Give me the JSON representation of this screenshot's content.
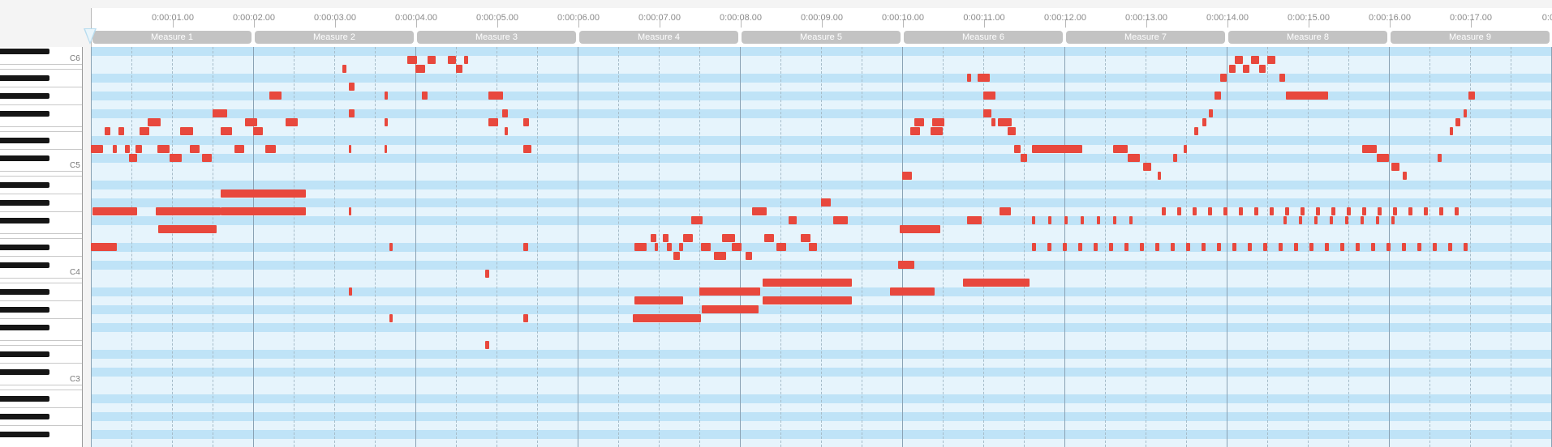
{
  "timeline": {
    "time_labels": [
      "0:00:01.00",
      "0:00:02.00",
      "0:00:03.00",
      "0:00:04.00",
      "0:00:05.00",
      "0:00:06.00",
      "0:00:07.00",
      "0:00:08.00",
      "0:00:09.00",
      "0:00:10.00",
      "0:00:11.00",
      "0:00:12.00",
      "0:00:13.00",
      "0:00:14.00",
      "0:00:15.00",
      "0:00:16.00",
      "0:00:17.00",
      "0:00:"
    ],
    "measures": [
      "Measure 1",
      "Measure 2",
      "Measure 3",
      "Measure 4",
      "Measure 5",
      "Measure 6",
      "Measure 7",
      "Measure 8",
      "Measure 9"
    ]
  },
  "keyboard": {
    "octave_labels": [
      "C6",
      "C5",
      "C4",
      "C3"
    ]
  },
  "notes": [
    {
      "time": 4.1,
      "duration": 0.05,
      "pitch": 83
    },
    {
      "time": 4.9,
      "duration": 0.12,
      "pitch": 84
    },
    {
      "time": 5.0,
      "duration": 0.12,
      "pitch": 83
    },
    {
      "time": 5.15,
      "duration": 0.1,
      "pitch": 84
    },
    {
      "time": 5.4,
      "duration": 0.1,
      "pitch": 84
    },
    {
      "time": 5.5,
      "duration": 0.08,
      "pitch": 83
    },
    {
      "time": 5.6,
      "duration": 0.05,
      "pitch": 84
    },
    {
      "time": 3.2,
      "duration": 0.15,
      "pitch": 80
    },
    {
      "time": 2.5,
      "duration": 0.18,
      "pitch": 78
    },
    {
      "time": 2.9,
      "duration": 0.15,
      "pitch": 77
    },
    {
      "time": 3.4,
      "duration": 0.15,
      "pitch": 77
    },
    {
      "time": 1.7,
      "duration": 0.16,
      "pitch": 77
    },
    {
      "time": 1.17,
      "duration": 0.07,
      "pitch": 76
    },
    {
      "time": 1.34,
      "duration": 0.07,
      "pitch": 76
    },
    {
      "time": 1.6,
      "duration": 0.12,
      "pitch": 76
    },
    {
      "time": 2.1,
      "duration": 0.16,
      "pitch": 76
    },
    {
      "time": 2.6,
      "duration": 0.14,
      "pitch": 76
    },
    {
      "time": 3.0,
      "duration": 0.12,
      "pitch": 76
    },
    {
      "time": 1.0,
      "duration": 0.15,
      "pitch": 74
    },
    {
      "time": 1.27,
      "duration": 0.05,
      "pitch": 74
    },
    {
      "time": 1.42,
      "duration": 0.06,
      "pitch": 74
    },
    {
      "time": 1.55,
      "duration": 0.08,
      "pitch": 74
    },
    {
      "time": 1.82,
      "duration": 0.15,
      "pitch": 74
    },
    {
      "time": 2.22,
      "duration": 0.12,
      "pitch": 74
    },
    {
      "time": 2.77,
      "duration": 0.12,
      "pitch": 74
    },
    {
      "time": 3.15,
      "duration": 0.13,
      "pitch": 74
    },
    {
      "time": 1.47,
      "duration": 0.1,
      "pitch": 73
    },
    {
      "time": 1.97,
      "duration": 0.15,
      "pitch": 73
    },
    {
      "time": 2.37,
      "duration": 0.12,
      "pitch": 73
    },
    {
      "time": 2.6,
      "duration": 1.05,
      "pitch": 69
    },
    {
      "time": 1.02,
      "duration": 0.55,
      "pitch": 67
    },
    {
      "time": 1.8,
      "duration": 0.8,
      "pitch": 67
    },
    {
      "time": 2.6,
      "duration": 1.05,
      "pitch": 67
    },
    {
      "time": 1.83,
      "duration": 0.72,
      "pitch": 65
    },
    {
      "time": 1.0,
      "duration": 0.32,
      "pitch": 63
    },
    {
      "time": 4.18,
      "duration": 0.07,
      "pitch": 81
    },
    {
      "time": 4.62,
      "duration": 0.04,
      "pitch": 80
    },
    {
      "time": 5.08,
      "duration": 0.07,
      "pitch": 80
    },
    {
      "time": 5.9,
      "duration": 0.18,
      "pitch": 80
    },
    {
      "time": 4.18,
      "duration": 0.07,
      "pitch": 78
    },
    {
      "time": 4.62,
      "duration": 0.04,
      "pitch": 77
    },
    {
      "time": 5.9,
      "duration": 0.12,
      "pitch": 77
    },
    {
      "time": 6.07,
      "duration": 0.07,
      "pitch": 78
    },
    {
      "time": 6.33,
      "duration": 0.07,
      "pitch": 77
    },
    {
      "time": 6.1,
      "duration": 0.04,
      "pitch": 76
    },
    {
      "time": 4.18,
      "duration": 0.03,
      "pitch": 74
    },
    {
      "time": 4.62,
      "duration": 0.03,
      "pitch": 74
    },
    {
      "time": 6.33,
      "duration": 0.1,
      "pitch": 74
    },
    {
      "time": 4.18,
      "duration": 0.03,
      "pitch": 67
    },
    {
      "time": 4.68,
      "duration": 0.04,
      "pitch": 63
    },
    {
      "time": 6.33,
      "duration": 0.06,
      "pitch": 63
    },
    {
      "time": 5.86,
      "duration": 0.05,
      "pitch": 60
    },
    {
      "time": 4.18,
      "duration": 0.04,
      "pitch": 58
    },
    {
      "time": 4.68,
      "duration": 0.04,
      "pitch": 55
    },
    {
      "time": 6.33,
      "duration": 0.06,
      "pitch": 55
    },
    {
      "time": 5.86,
      "duration": 0.05,
      "pitch": 52
    },
    {
      "time": 7.9,
      "duration": 0.07,
      "pitch": 64
    },
    {
      "time": 8.05,
      "duration": 0.07,
      "pitch": 64
    },
    {
      "time": 8.3,
      "duration": 0.12,
      "pitch": 64
    },
    {
      "time": 8.78,
      "duration": 0.16,
      "pitch": 64
    },
    {
      "time": 9.3,
      "duration": 0.12,
      "pitch": 64
    },
    {
      "time": 9.75,
      "duration": 0.12,
      "pitch": 64
    },
    {
      "time": 8.4,
      "duration": 0.14,
      "pitch": 66
    },
    {
      "time": 9.15,
      "duration": 0.18,
      "pitch": 67
    },
    {
      "time": 9.6,
      "duration": 0.1,
      "pitch": 66
    },
    {
      "time": 10.15,
      "duration": 0.18,
      "pitch": 66
    },
    {
      "time": 7.7,
      "duration": 0.15,
      "pitch": 63
    },
    {
      "time": 7.95,
      "duration": 0.04,
      "pitch": 63
    },
    {
      "time": 8.1,
      "duration": 0.06,
      "pitch": 63
    },
    {
      "time": 8.25,
      "duration": 0.05,
      "pitch": 63
    },
    {
      "time": 8.52,
      "duration": 0.12,
      "pitch": 63
    },
    {
      "time": 8.9,
      "duration": 0.12,
      "pitch": 63
    },
    {
      "time": 9.45,
      "duration": 0.12,
      "pitch": 63
    },
    {
      "time": 9.85,
      "duration": 0.1,
      "pitch": 63
    },
    {
      "time": 8.18,
      "duration": 0.08,
      "pitch": 62
    },
    {
      "time": 8.68,
      "duration": 0.15,
      "pitch": 62
    },
    {
      "time": 9.07,
      "duration": 0.08,
      "pitch": 62
    },
    {
      "time": 9.28,
      "duration": 1.1,
      "pitch": 59
    },
    {
      "time": 7.7,
      "duration": 0.6,
      "pitch": 57
    },
    {
      "time": 8.5,
      "duration": 0.75,
      "pitch": 58
    },
    {
      "time": 9.28,
      "duration": 1.1,
      "pitch": 57
    },
    {
      "time": 8.53,
      "duration": 0.7,
      "pitch": 56
    },
    {
      "time": 7.68,
      "duration": 0.84,
      "pitch": 55
    },
    {
      "time": 10.0,
      "duration": 0.12,
      "pitch": 68
    },
    {
      "time": 11.0,
      "duration": 0.12,
      "pitch": 71
    },
    {
      "time": 10.97,
      "duration": 0.5,
      "pitch": 65
    },
    {
      "time": 10.95,
      "duration": 0.2,
      "pitch": 61
    },
    {
      "time": 10.85,
      "duration": 0.55,
      "pitch": 58
    },
    {
      "time": 11.75,
      "duration": 0.82,
      "pitch": 59
    },
    {
      "time": 11.15,
      "duration": 0.12,
      "pitch": 77
    },
    {
      "time": 11.37,
      "duration": 0.15,
      "pitch": 77
    },
    {
      "time": 11.1,
      "duration": 0.12,
      "pitch": 76
    },
    {
      "time": 11.35,
      "duration": 0.15,
      "pitch": 76
    },
    {
      "time": 11.8,
      "duration": 0.05,
      "pitch": 82
    },
    {
      "time": 11.93,
      "duration": 0.15,
      "pitch": 82
    },
    {
      "time": 12.0,
      "duration": 0.15,
      "pitch": 80
    },
    {
      "time": 12.0,
      "duration": 0.1,
      "pitch": 78
    },
    {
      "time": 12.1,
      "duration": 0.05,
      "pitch": 77
    },
    {
      "time": 12.18,
      "duration": 0.17,
      "pitch": 77
    },
    {
      "time": 12.3,
      "duration": 0.1,
      "pitch": 76
    },
    {
      "time": 12.38,
      "duration": 0.08,
      "pitch": 74
    },
    {
      "time": 12.46,
      "duration": 0.08,
      "pitch": 73
    },
    {
      "time": 12.6,
      "duration": 0.62,
      "pitch": 74
    },
    {
      "time": 13.6,
      "duration": 0.18,
      "pitch": 74
    },
    {
      "time": 13.78,
      "duration": 0.15,
      "pitch": 73
    },
    {
      "time": 13.97,
      "duration": 0.1,
      "pitch": 72
    },
    {
      "time": 14.15,
      "duration": 0.04,
      "pitch": 71
    },
    {
      "time": 11.8,
      "duration": 0.18,
      "pitch": 66
    },
    {
      "time": 12.2,
      "duration": 0.14,
      "pitch": 67
    },
    {
      "time": 14.34,
      "duration": 0.05,
      "pitch": 73
    },
    {
      "time": 14.47,
      "duration": 0.04,
      "pitch": 74
    },
    {
      "time": 14.6,
      "duration": 0.05,
      "pitch": 76
    },
    {
      "time": 14.7,
      "duration": 0.05,
      "pitch": 77
    },
    {
      "time": 14.78,
      "duration": 0.05,
      "pitch": 78
    },
    {
      "time": 14.85,
      "duration": 0.08,
      "pitch": 80
    },
    {
      "time": 14.92,
      "duration": 0.08,
      "pitch": 82
    },
    {
      "time": 15.03,
      "duration": 0.08,
      "pitch": 83
    },
    {
      "time": 15.1,
      "duration": 0.1,
      "pitch": 84
    },
    {
      "time": 15.2,
      "duration": 0.08,
      "pitch": 83
    },
    {
      "time": 15.3,
      "duration": 0.1,
      "pitch": 84
    },
    {
      "time": 15.4,
      "duration": 0.08,
      "pitch": 83
    },
    {
      "time": 15.5,
      "duration": 0.1,
      "pitch": 84
    },
    {
      "time": 15.65,
      "duration": 0.07,
      "pitch": 82
    },
    {
      "time": 15.73,
      "duration": 0.52,
      "pitch": 80
    },
    {
      "time": 16.67,
      "duration": 0.18,
      "pitch": 74
    },
    {
      "time": 16.85,
      "duration": 0.15,
      "pitch": 73
    },
    {
      "time": 17.03,
      "duration": 0.1,
      "pitch": 72
    },
    {
      "time": 17.17,
      "duration": 0.05,
      "pitch": 71
    },
    {
      "time": 17.6,
      "duration": 0.05,
      "pitch": 73
    },
    {
      "time": 17.75,
      "duration": 0.04,
      "pitch": 76
    },
    {
      "time": 17.82,
      "duration": 0.06,
      "pitch": 77
    },
    {
      "time": 17.92,
      "duration": 0.04,
      "pitch": 78
    },
    {
      "time": 17.98,
      "duration": 0.08,
      "pitch": 80
    }
  ],
  "repeat_notes": [
    {
      "start": 14.2,
      "end": 17.9,
      "step": 0.19,
      "pitch": 67,
      "duration": 0.05
    },
    {
      "start": 12.6,
      "end": 13.9,
      "step": 0.2,
      "pitch": 66,
      "duration": 0.04
    },
    {
      "start": 15.7,
      "end": 17.1,
      "step": 0.19,
      "pitch": 66,
      "duration": 0.04
    },
    {
      "start": 12.6,
      "end": 18.0,
      "step": 0.19,
      "pitch": 63,
      "duration": 0.05
    }
  ]
}
